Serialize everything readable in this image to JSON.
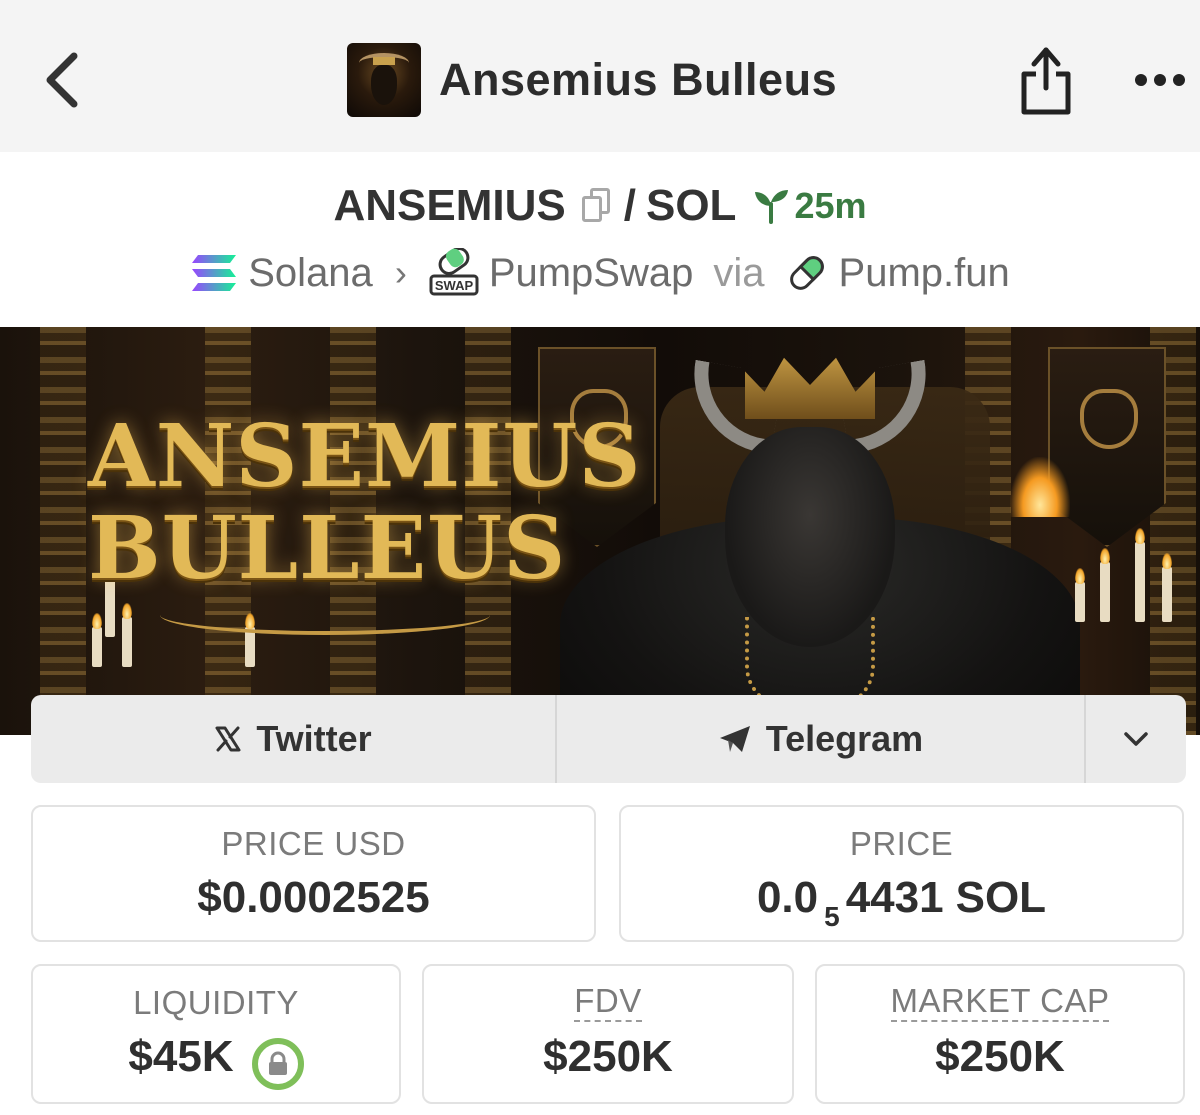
{
  "nav": {
    "title": "Ansemius Bulleus",
    "back_icon": "chevron-left-icon",
    "share_icon": "share-icon",
    "more_icon": "ellipsis-icon"
  },
  "pair": {
    "base": "ANSEMIUS",
    "separator": "/",
    "quote": "SOL",
    "age": "25m"
  },
  "chain": {
    "network": "Solana",
    "dex": "PumpSwap",
    "dex_badge": "SWAP",
    "via": "via",
    "launchpad": "Pump.fun"
  },
  "banner": {
    "line1": "ANSEMIUS",
    "line2": "BULLEUS"
  },
  "socials": {
    "twitter_label": "Twitter",
    "telegram_label": "Telegram"
  },
  "stats": {
    "price_usd_label": "PRICE USD",
    "price_usd_value": "$0.0002525",
    "price_label": "PRICE",
    "price_prefix": "0.0",
    "price_zeros": "5",
    "price_digits": "4431",
    "price_unit": "SOL",
    "liquidity_label": "LIQUIDITY",
    "liquidity_value": "$45K",
    "fdv_label": "FDV",
    "fdv_value": "$250K",
    "mcap_label": "MARKET CAP",
    "mcap_value": "$250K"
  },
  "colors": {
    "age_green": "#3a7b42",
    "lock_green": "#7fbf5a",
    "banner_gold": "#e2b957"
  }
}
